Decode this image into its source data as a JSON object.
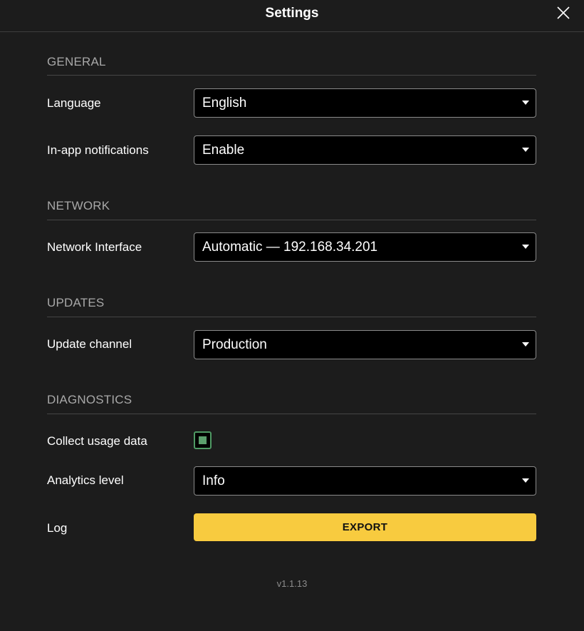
{
  "header": {
    "title": "Settings",
    "close_icon": "close-icon"
  },
  "sections": {
    "general": {
      "title": "GENERAL",
      "language": {
        "label": "Language",
        "value": "English"
      },
      "notifications": {
        "label": "In-app notifications",
        "value": "Enable"
      }
    },
    "network": {
      "title": "NETWORK",
      "interface": {
        "label": "Network Interface",
        "value": "Automatic — 192.168.34.201"
      }
    },
    "updates": {
      "title": "UPDATES",
      "channel": {
        "label": "Update channel",
        "value": "Production"
      }
    },
    "diagnostics": {
      "title": "DIAGNOSTICS",
      "usage": {
        "label": "Collect usage data",
        "checked": true
      },
      "analytics": {
        "label": "Analytics level",
        "value": "Info"
      },
      "log": {
        "label": "Log",
        "button": "EXPORT"
      }
    }
  },
  "footer": {
    "version": "v1.1.13"
  },
  "colors": {
    "background": "#1c1c1c",
    "accent_button": "#f8cb3f",
    "checkbox": "#5c9f6d",
    "section_title": "#a8a8a8"
  }
}
